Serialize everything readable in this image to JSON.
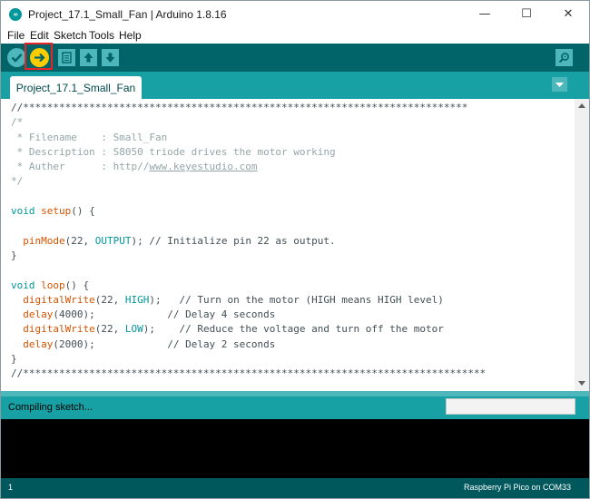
{
  "window": {
    "title": "Project_17.1_Small_Fan | Arduino 1.8.16",
    "icon_text": "∞",
    "minimize_glyph": "—",
    "maximize_glyph": "☐",
    "close_glyph": "✕"
  },
  "menu": [
    {
      "label": "File"
    },
    {
      "label": "Edit"
    },
    {
      "label": "Sketch"
    },
    {
      "label": "Tools"
    },
    {
      "label": "Help"
    }
  ],
  "toolbar": {
    "buttons": [
      "verify-icon",
      "upload-icon",
      "new-icon",
      "open-icon",
      "save-icon"
    ],
    "right_button": "serial-monitor-icon",
    "highlighted_button": "upload-icon",
    "highlight_color": "#e8262a"
  },
  "tab": {
    "label": "Project_17.1_Small_Fan",
    "menu_icon": "tab-menu-triangle-icon"
  },
  "code": {
    "line01": "//**************************************************************************",
    "line02": "/*",
    "line03": " * Filename    : Small_Fan",
    "line04": " * Description : S8050 triode drives the motor working",
    "line05_pre": " * Auther      : http//",
    "line05_url": "www.keyestudio.com",
    "line06": "*/",
    "line08_kw": "void",
    "line08_fn": "setup",
    "line08_rest": "() {",
    "line10_fn": "pinMode",
    "line10_a": "(22, ",
    "line10_kw": "OUTPUT",
    "line10_rest": "); // Initialize pin 22 as output.",
    "line11": "}",
    "line13_kw": "void",
    "line13_fn": "loop",
    "line13_rest": "() {",
    "line14_fn": "digitalWrite",
    "line14_a": "(22, ",
    "line14_kw": "HIGH",
    "line14_rest": ");   // Turn on the motor (HIGH means HIGH level)",
    "line15_fn": "delay",
    "line15_rest": "(4000);            // Delay 4 seconds",
    "line16_fn": "digitalWrite",
    "line16_a": "(22, ",
    "line16_kw": "LOW",
    "line16_rest": ");    // Reduce the voltage and turn off the motor",
    "line17_fn": "delay",
    "line17_rest": "(2000);            // Delay 2 seconds",
    "line18": "}",
    "line19": "//*****************************************************************************"
  },
  "status": {
    "message": "Compiling sketch...",
    "progress": 0
  },
  "footer": {
    "line_number": "1",
    "board": "Raspberry Pi Pico on COM33"
  },
  "colors": {
    "teal_dark": "#006468",
    "teal": "#17a1a5",
    "teal_light": "#4db7bb",
    "keyword": "#00979c",
    "function": "#d35400",
    "comment": "#95a5a6",
    "upload_button": "#ffcc00"
  }
}
